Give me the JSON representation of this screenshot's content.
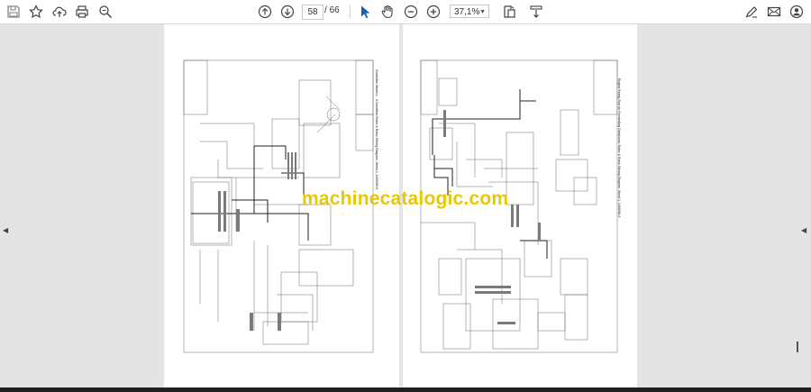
{
  "toolbar": {
    "page_current": "58",
    "page_separator": "/",
    "page_total": "66",
    "zoom": "37,1%",
    "left_icons": [
      "save-icon",
      "bookmark-star-icon",
      "upload-cloud-icon",
      "print-icon",
      "zoom-search-icon"
    ],
    "center_icons": [
      "page-up-icon",
      "page-down-icon",
      "select-pointer-icon",
      "hand-pan-icon",
      "zoom-out-icon",
      "zoom-in-icon",
      "fit-page-icon",
      "scroll-mode-icon"
    ],
    "right_icons": [
      "sign-pen-icon",
      "email-icon",
      "account-icon"
    ],
    "accent_color": "#1a5fb4"
  },
  "document": {
    "left_page_title": "Gradsthm Master™ II Condition Rotor & Rotor Wiring Diagram, Sheet 1, 1400096-S",
    "right_page_title": "Engine Ready Run for Prestarting Databoom, Rotor & Rotor Wiring Diagram, Sheet 1, 1400098-S"
  },
  "watermark": {
    "text": "machinecatalogic.com",
    "color": "#e8c800"
  }
}
